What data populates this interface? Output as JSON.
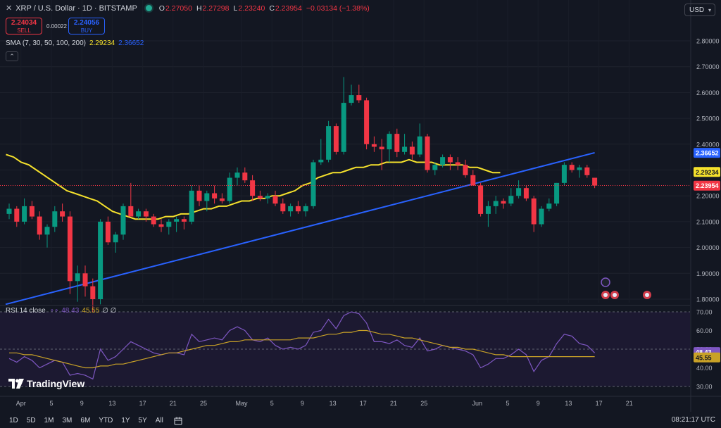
{
  "header": {
    "symbol": "XRP / U.S. Dollar · 1D · BITSTAMP",
    "ohlc": [
      {
        "k": "O",
        "v": "2.27050"
      },
      {
        "k": "H",
        "v": "2.27298"
      },
      {
        "k": "L",
        "v": "2.23240"
      },
      {
        "k": "C",
        "v": "2.23954"
      },
      {
        "k": "",
        "v": "−0.03134 (−1.38%)"
      }
    ]
  },
  "trade": {
    "sell_price": "2.24034",
    "sell_label": "SELL",
    "buy_price": "2.24056",
    "buy_label": "BUY",
    "spread": "0.00022"
  },
  "sma_legend": {
    "label": "SMA (7, 30, 50, 100, 200)",
    "v1": "2.29234",
    "v2": "2.36652"
  },
  "rsi_legend": {
    "label": "RSI 14 close",
    "v1": "48.43",
    "v2": "45.55",
    "extra": "∅ ∅"
  },
  "currency_button": "USD",
  "brand": "TradingView",
  "timeframes": [
    "1D",
    "5D",
    "1M",
    "3M",
    "6M",
    "YTD",
    "1Y",
    "5Y",
    "All"
  ],
  "clock": "08:21:17 UTC",
  "colors": {
    "up": "#089981",
    "down": "#f23645",
    "sma_short": "#f5e12c",
    "sma_long": "#2962ff",
    "rsi": "#7e57c2",
    "rsi_ma": "#c9a227",
    "bg": "#131722"
  },
  "chart_data": {
    "type": "candlestick",
    "price_axis": {
      "ticks": [
        "2.80000",
        "2.70000",
        "2.60000",
        "2.50000",
        "2.40000",
        "2.30000",
        "2.20000",
        "2.10000",
        "2.00000",
        "1.90000",
        "1.80000"
      ]
    },
    "price_labels": [
      {
        "value": 2.36652,
        "text": "2.36652",
        "color": "#2962ff"
      },
      {
        "value": 2.29234,
        "text": "2.29234",
        "color": "#f5e12c"
      },
      {
        "value": 2.23954,
        "text": "2.23954",
        "color": "#f23645"
      }
    ],
    "x_labels": [
      {
        "i": 1,
        "text": "Apr"
      },
      {
        "i": 5,
        "text": "5"
      },
      {
        "i": 9,
        "text": "9"
      },
      {
        "i": 13,
        "text": "13"
      },
      {
        "i": 17,
        "text": "17"
      },
      {
        "i": 21,
        "text": "21"
      },
      {
        "i": 25,
        "text": "25"
      },
      {
        "i": 30,
        "text": "May"
      },
      {
        "i": 34,
        "text": "5"
      },
      {
        "i": 38,
        "text": "9"
      },
      {
        "i": 42,
        "text": "13"
      },
      {
        "i": 46,
        "text": "17"
      },
      {
        "i": 50,
        "text": "21"
      },
      {
        "i": 54,
        "text": "25"
      },
      {
        "i": 61,
        "text": "Jun"
      },
      {
        "i": 65,
        "text": "5"
      },
      {
        "i": 69,
        "text": "9"
      },
      {
        "i": 73,
        "text": "13"
      },
      {
        "i": 77,
        "text": "17"
      },
      {
        "i": 81,
        "text": "21"
      }
    ],
    "candles": [
      [
        2.13,
        2.17,
        2.11,
        2.15
      ],
      [
        2.15,
        2.16,
        2.08,
        2.1
      ],
      [
        2.1,
        2.19,
        2.09,
        2.16
      ],
      [
        2.16,
        2.18,
        2.11,
        2.12
      ],
      [
        2.12,
        2.14,
        2.03,
        2.05
      ],
      [
        2.05,
        2.09,
        2.0,
        2.08
      ],
      [
        2.08,
        2.16,
        2.06,
        2.14
      ],
      [
        2.14,
        2.17,
        2.1,
        2.12
      ],
      [
        2.12,
        2.14,
        1.82,
        1.87
      ],
      [
        1.87,
        1.93,
        1.79,
        1.9
      ],
      [
        1.9,
        1.93,
        1.81,
        1.85
      ],
      [
        1.85,
        1.88,
        1.75,
        1.8
      ],
      [
        1.8,
        2.11,
        1.78,
        2.1
      ],
      [
        2.1,
        2.12,
        2.01,
        2.02
      ],
      [
        2.02,
        2.06,
        1.98,
        2.05
      ],
      [
        2.05,
        2.17,
        2.03,
        2.16
      ],
      [
        2.16,
        2.25,
        2.13,
        2.12
      ],
      [
        2.12,
        2.15,
        2.11,
        2.14
      ],
      [
        2.14,
        2.15,
        2.1,
        2.12
      ],
      [
        2.12,
        2.13,
        2.08,
        2.09
      ],
      [
        2.09,
        2.11,
        2.06,
        2.08
      ],
      [
        2.08,
        2.11,
        2.05,
        2.1
      ],
      [
        2.1,
        2.12,
        2.06,
        2.11
      ],
      [
        2.11,
        2.12,
        2.07,
        2.1
      ],
      [
        2.1,
        2.24,
        2.09,
        2.22
      ],
      [
        2.22,
        2.24,
        2.16,
        2.18
      ],
      [
        2.18,
        2.22,
        2.14,
        2.21
      ],
      [
        2.21,
        2.24,
        2.17,
        2.19
      ],
      [
        2.19,
        2.21,
        2.17,
        2.18
      ],
      [
        2.18,
        2.29,
        2.17,
        2.27
      ],
      [
        2.27,
        2.31,
        2.24,
        2.29
      ],
      [
        2.29,
        2.31,
        2.25,
        2.26
      ],
      [
        2.26,
        2.28,
        2.18,
        2.2
      ],
      [
        2.2,
        2.22,
        2.18,
        2.19
      ],
      [
        2.19,
        2.21,
        2.17,
        2.2
      ],
      [
        2.2,
        2.22,
        2.16,
        2.17
      ],
      [
        2.17,
        2.19,
        2.13,
        2.14
      ],
      [
        2.14,
        2.17,
        2.12,
        2.16
      ],
      [
        2.16,
        2.18,
        2.13,
        2.14
      ],
      [
        2.14,
        2.17,
        2.12,
        2.16
      ],
      [
        2.16,
        2.34,
        2.15,
        2.33
      ],
      [
        2.33,
        2.42,
        2.32,
        2.34
      ],
      [
        2.34,
        2.49,
        2.33,
        2.47
      ],
      [
        2.47,
        2.48,
        2.36,
        2.37
      ],
      [
        2.37,
        2.66,
        2.36,
        2.56
      ],
      [
        2.56,
        2.63,
        2.55,
        2.59
      ],
      [
        2.59,
        2.63,
        2.56,
        2.57
      ],
      [
        2.57,
        2.58,
        2.38,
        2.4
      ],
      [
        2.4,
        2.43,
        2.37,
        2.39
      ],
      [
        2.39,
        2.42,
        2.3,
        2.38
      ],
      [
        2.38,
        2.45,
        2.33,
        2.44
      ],
      [
        2.44,
        2.46,
        2.35,
        2.37
      ],
      [
        2.37,
        2.44,
        2.36,
        2.39
      ],
      [
        2.39,
        2.41,
        2.34,
        2.36
      ],
      [
        2.36,
        2.48,
        2.35,
        2.43
      ],
      [
        2.43,
        2.44,
        2.29,
        2.3
      ],
      [
        2.3,
        2.33,
        2.28,
        2.32
      ],
      [
        2.32,
        2.36,
        2.31,
        2.35
      ],
      [
        2.35,
        2.36,
        2.3,
        2.33
      ],
      [
        2.33,
        2.35,
        2.3,
        2.32
      ],
      [
        2.32,
        2.34,
        2.27,
        2.28
      ],
      [
        2.28,
        2.3,
        2.26,
        2.24
      ],
      [
        2.24,
        2.25,
        2.12,
        2.13
      ],
      [
        2.13,
        2.18,
        2.08,
        2.16
      ],
      [
        2.16,
        2.2,
        2.13,
        2.18
      ],
      [
        2.18,
        2.19,
        2.15,
        2.17
      ],
      [
        2.17,
        2.23,
        2.16,
        2.2
      ],
      [
        2.2,
        2.26,
        2.19,
        2.23
      ],
      [
        2.23,
        2.24,
        2.18,
        2.19
      ],
      [
        2.19,
        2.2,
        2.06,
        2.09
      ],
      [
        2.09,
        2.16,
        2.08,
        2.15
      ],
      [
        2.15,
        2.19,
        2.14,
        2.17
      ],
      [
        2.17,
        2.25,
        2.16,
        2.25
      ],
      [
        2.25,
        2.33,
        2.24,
        2.32
      ],
      [
        2.32,
        2.33,
        2.29,
        2.3
      ],
      [
        2.3,
        2.32,
        2.27,
        2.31
      ],
      [
        2.31,
        2.32,
        2.27,
        2.28
      ],
      [
        2.27,
        2.27,
        2.23,
        2.24
      ]
    ],
    "sma_short": [
      2.36,
      2.35,
      2.33,
      2.32,
      2.3,
      2.28,
      2.26,
      2.24,
      2.22,
      2.21,
      2.2,
      2.19,
      2.18,
      2.16,
      2.14,
      2.13,
      2.12,
      2.11,
      2.11,
      2.11,
      2.11,
      2.12,
      2.12,
      2.13,
      2.13,
      2.14,
      2.15,
      2.15,
      2.16,
      2.16,
      2.17,
      2.18,
      2.18,
      2.19,
      2.19,
      2.2,
      2.2,
      2.21,
      2.22,
      2.24,
      2.25,
      2.27,
      2.28,
      2.29,
      2.29,
      2.3,
      2.31,
      2.31,
      2.32,
      2.32,
      2.33,
      2.33,
      2.33,
      2.34,
      2.33,
      2.33,
      2.33,
      2.32,
      2.32,
      2.32,
      2.32,
      2.31,
      2.31,
      2.3,
      2.29,
      2.29
    ],
    "sma_short_start": 0,
    "sma_long_start": 0,
    "sma_long_end": {
      "i": 77,
      "value": 2.367
    },
    "sma_long_begin": {
      "i": 0,
      "value": 1.78
    },
    "rsi_axis": {
      "ticks": [
        "70.00",
        "60.00",
        "50.00",
        "40.00",
        "30.00"
      ],
      "levels": [
        70,
        50,
        30
      ]
    },
    "rsi_labels": [
      {
        "value": 48.43,
        "text": "48.43",
        "color": "#7e57c2"
      },
      {
        "value": 45.55,
        "text": "45.55",
        "color": "#c9a227"
      }
    ],
    "rsi": [
      45,
      43,
      46,
      44,
      40,
      42,
      44,
      43,
      36,
      37,
      36,
      34,
      50,
      44,
      46,
      50,
      54,
      52,
      50,
      48,
      47,
      48,
      48,
      47,
      58,
      54,
      55,
      56,
      55,
      60,
      62,
      60,
      55,
      54,
      56,
      52,
      50,
      51,
      50,
      52,
      59,
      60,
      66,
      61,
      68,
      70,
      69,
      64,
      54,
      54,
      53,
      55,
      52,
      51,
      56,
      49,
      50,
      52,
      51,
      50,
      49,
      47,
      40,
      42,
      45,
      45,
      47,
      50,
      47,
      38,
      44,
      46,
      53,
      58,
      57,
      53,
      52,
      48
    ],
    "rsi_ma": [
      48,
      48,
      47,
      47,
      46,
      45,
      44,
      43,
      42,
      41,
      40,
      40,
      41,
      41,
      42,
      42,
      43,
      44,
      45,
      46,
      47,
      48,
      48,
      49,
      50,
      51,
      52,
      52,
      53,
      54,
      54,
      55,
      55,
      55,
      55,
      55,
      55,
      55,
      56,
      56,
      56,
      57,
      58,
      58,
      59,
      59,
      60,
      60,
      59,
      58,
      58,
      57,
      56,
      56,
      55,
      54,
      53,
      52,
      51,
      51,
      50,
      50,
      49,
      48,
      47,
      47,
      46,
      46,
      46,
      46,
      46,
      46,
      46,
      46,
      46,
      46,
      46,
      46
    ]
  }
}
